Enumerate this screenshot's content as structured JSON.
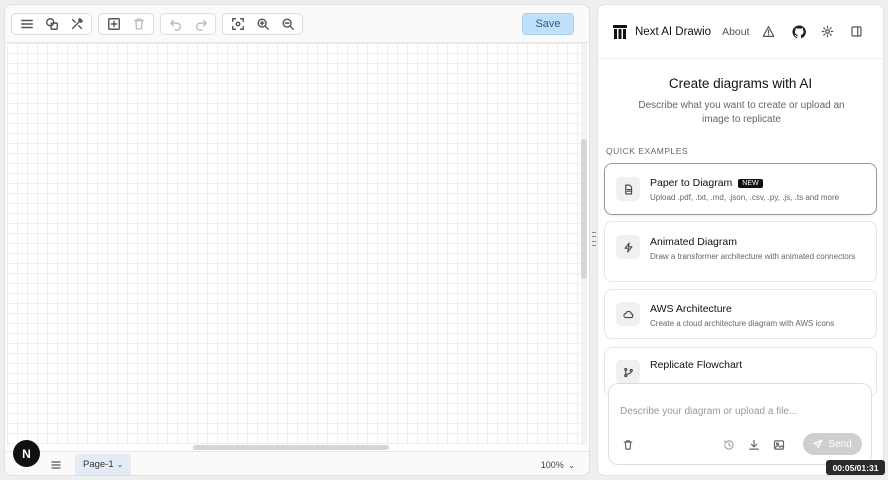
{
  "toolbar": {
    "save_label": "Save"
  },
  "footer": {
    "page_label": "Page-1",
    "zoom_label": "100%"
  },
  "n_badge": "N",
  "header": {
    "app_name": "Next AI Drawio",
    "about_label": "About"
  },
  "welcome": {
    "title": "Create diagrams with AI",
    "subtitle": "Describe what you want to create or upload an image to replicate"
  },
  "quick_examples": {
    "heading": "QUICK EXAMPLES",
    "items": [
      {
        "title": "Paper to Diagram",
        "badge": "NEW",
        "description": "Upload .pdf, .txt, .md, .json, .csv, .py, .js, .ts and more",
        "icon": "file-icon"
      },
      {
        "title": "Animated Diagram",
        "description": "Draw a transformer architecture with animated connectors",
        "icon": "zap-icon"
      },
      {
        "title": "AWS Architecture",
        "description": "Create a cloud architecture diagram with AWS icons",
        "icon": "cloud-icon"
      },
      {
        "title": "Replicate Flowchart",
        "description": "",
        "icon": "git-branch-icon"
      }
    ]
  },
  "composer": {
    "placeholder": "Describe your diagram or upload a file...",
    "send_label": "Send"
  },
  "timer": "00:05/01:31",
  "colors": {
    "save_button": "#bfe0fb",
    "new_badge": "#111111",
    "send_button": "#cfcfcf"
  }
}
